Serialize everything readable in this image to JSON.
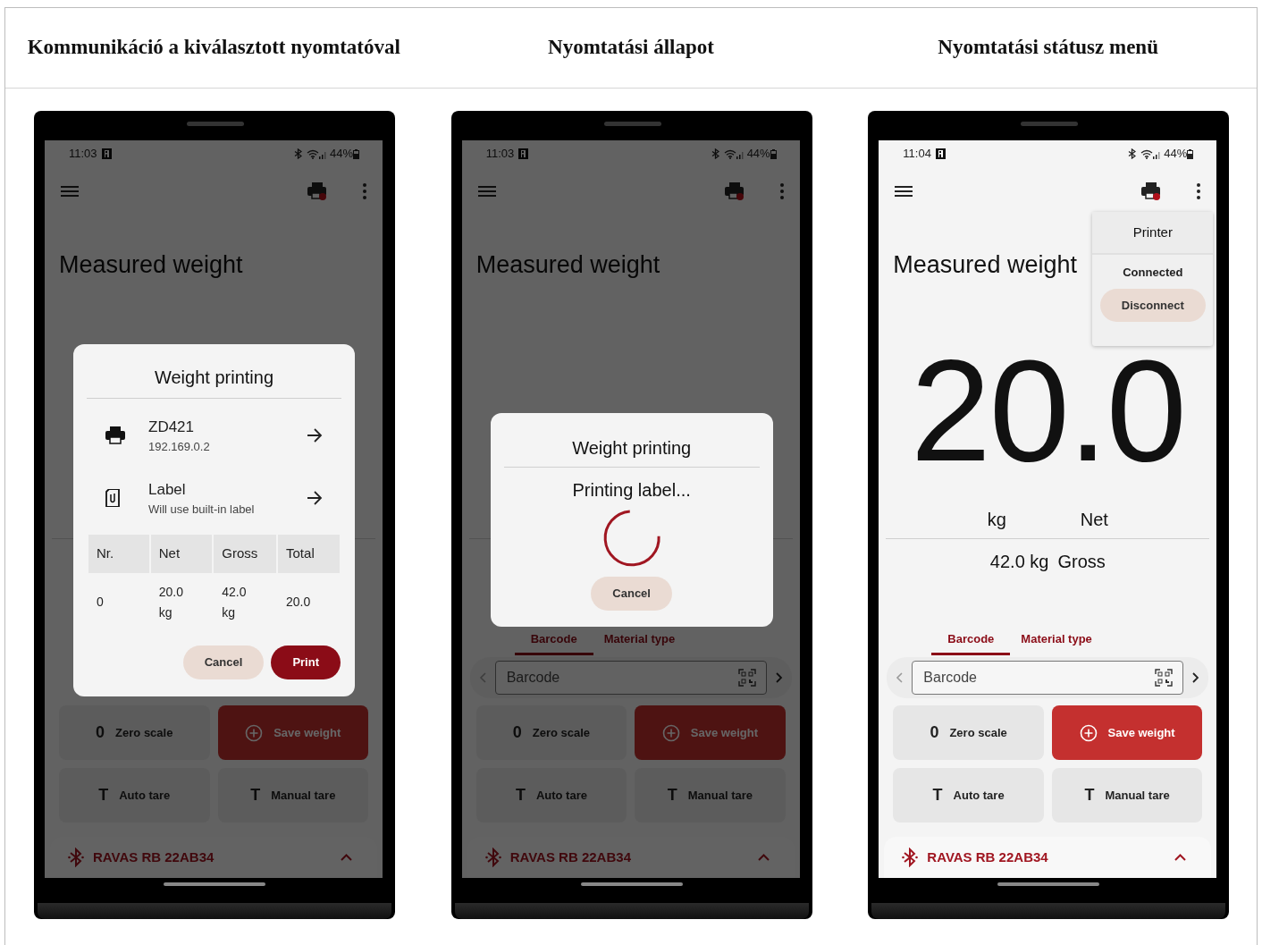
{
  "columns": [
    {
      "heading": "Kommunikáció a kiválasztott nyomtatóval",
      "phone": {
        "time": "11:03",
        "battery": "44%",
        "dimmed": true,
        "title": "Measured weight",
        "buttons": [
          {
            "kind": "zero",
            "symbol": "0",
            "label": "Zero scale"
          },
          {
            "kind": "save",
            "label": "Save weight"
          },
          {
            "kind": "tare",
            "symbol": "T",
            "label": "Auto tare"
          },
          {
            "kind": "tare",
            "symbol": "T",
            "label": "Manual tare"
          }
        ],
        "device": "RAVAS RB 22AB34",
        "dialog": {
          "kind": "setup",
          "title": "Weight printing",
          "items": [
            {
              "kind": "printer",
              "title": "ZD421",
              "subtitle": "192.169.0.2"
            },
            {
              "kind": "label",
              "title": "Label",
              "subtitle": "Will use built-in label"
            }
          ],
          "table": {
            "columns": [
              "Nr.",
              "Net",
              "Gross",
              "Total"
            ],
            "rows": [
              [
                "0",
                "20.0 kg",
                "42.0 kg",
                "20.0"
              ]
            ]
          },
          "buttons": [
            {
              "kind": "secondary",
              "label": "Cancel"
            },
            {
              "kind": "primary",
              "label": "Print"
            }
          ]
        }
      }
    },
    {
      "heading": "Nyomtatási állapot",
      "phone": {
        "time": "11:03",
        "battery": "44%",
        "dimmed": true,
        "title": "Measured weight",
        "tabs": [
          {
            "label": "Barcode",
            "selected": true
          },
          {
            "label": "Material type",
            "selected": false
          }
        ],
        "barcode_placeholder": "Barcode",
        "buttons": [
          {
            "kind": "zero",
            "symbol": "0",
            "label": "Zero scale"
          },
          {
            "kind": "save",
            "label": "Save weight"
          },
          {
            "kind": "tare",
            "symbol": "T",
            "label": "Auto tare"
          },
          {
            "kind": "tare",
            "symbol": "T",
            "label": "Manual tare"
          }
        ],
        "device": "RAVAS RB 22AB34",
        "dialog": {
          "kind": "progress",
          "title": "Weight printing",
          "message": "Printing label...",
          "buttons": [
            {
              "kind": "secondary",
              "label": "Cancel"
            }
          ]
        }
      }
    },
    {
      "heading": "Nyomtatási státusz menü",
      "phone": {
        "time": "11:04",
        "battery": "44%",
        "dimmed": false,
        "title": "Measured weight",
        "reading": {
          "value": "20.0",
          "unit": "kg",
          "mode": "Net",
          "gross": "42.0 kg",
          "gross_label": "Gross"
        },
        "tabs": [
          {
            "label": "Barcode",
            "selected": true
          },
          {
            "label": "Material type",
            "selected": false
          }
        ],
        "barcode_placeholder": "Barcode",
        "buttons": [
          {
            "kind": "zero",
            "symbol": "0",
            "label": "Zero scale"
          },
          {
            "kind": "save",
            "label": "Save weight"
          },
          {
            "kind": "tare",
            "symbol": "T",
            "label": "Auto tare"
          },
          {
            "kind": "tare",
            "symbol": "T",
            "label": "Manual tare"
          }
        ],
        "device": "RAVAS RB 22AB34",
        "menu": {
          "title": "Printer",
          "status": "Connected",
          "button": "Disconnect"
        }
      }
    }
  ]
}
